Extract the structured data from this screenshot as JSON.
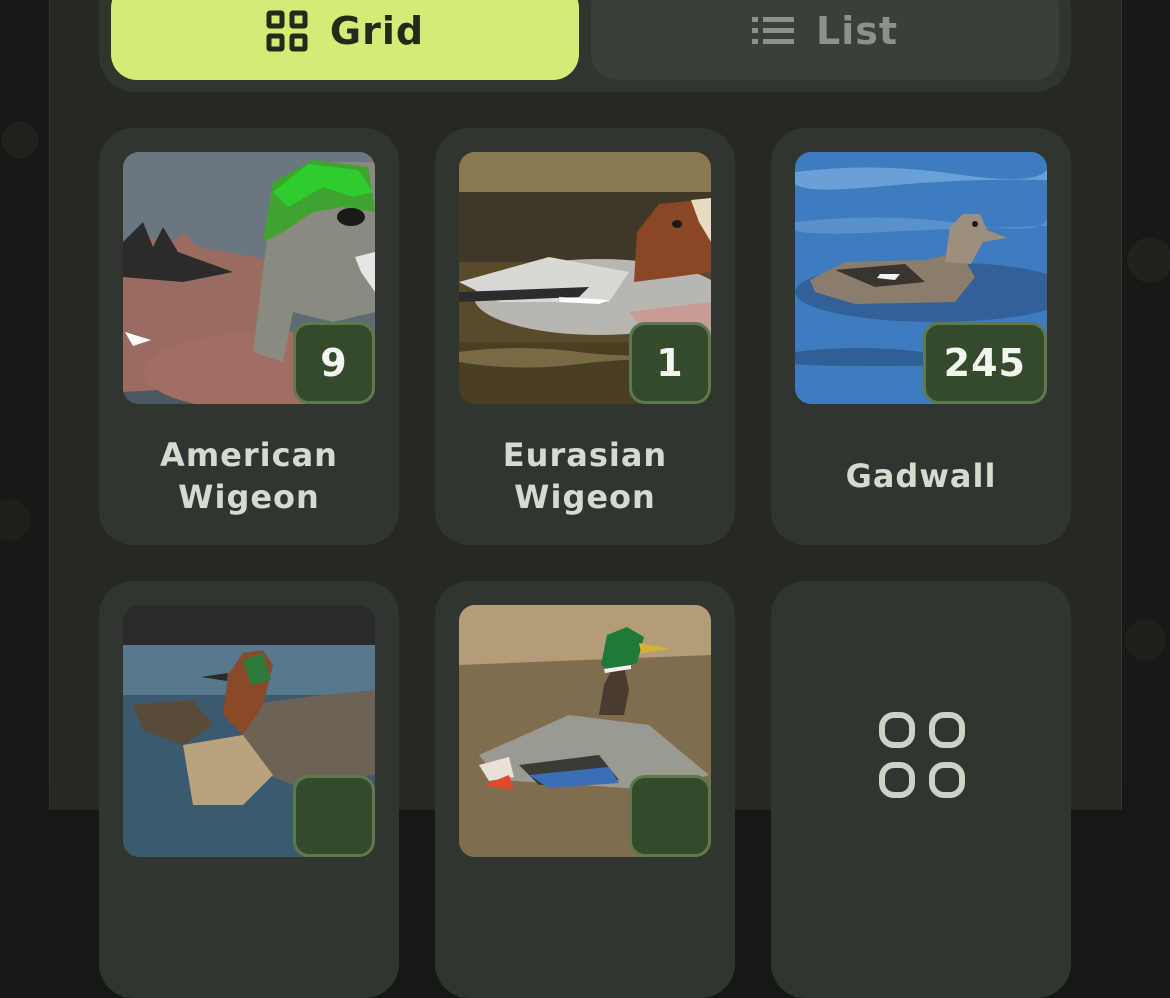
{
  "view_toggle": {
    "grid_label": "Grid",
    "list_label": "List",
    "selected": "Grid"
  },
  "species": [
    {
      "name": "American Wigeon",
      "count": "9"
    },
    {
      "name": "Eurasian Wigeon",
      "count": "1"
    },
    {
      "name": "Gadwall",
      "count": "245"
    },
    {
      "name": "",
      "count": ""
    },
    {
      "name": "",
      "count": ""
    }
  ],
  "icons": {
    "grid": "grid-icon",
    "list": "list-icon",
    "more": "apps-icon"
  },
  "colors": {
    "accent": "#d3ec76",
    "badge": "#344a2b",
    "card": "#31352f",
    "panel": "#252823"
  }
}
